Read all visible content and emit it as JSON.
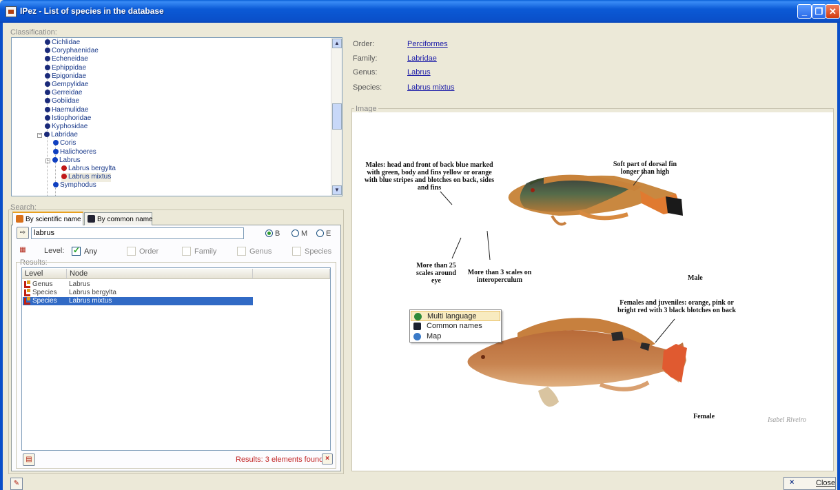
{
  "window": {
    "title": "IPez - List of species in the database",
    "controls": {
      "minimize": "_",
      "maximize": "❐",
      "close": "✕"
    }
  },
  "classification": {
    "label": "Classification:",
    "tree": [
      {
        "label": "Cichlidae",
        "level": "family",
        "icon": "family-node-icon"
      },
      {
        "label": "Coryphaenidae",
        "level": "family",
        "icon": "family-node-icon"
      },
      {
        "label": "Echeneidae",
        "level": "family",
        "icon": "family-node-icon"
      },
      {
        "label": "Ephippidae",
        "level": "family",
        "icon": "family-node-icon"
      },
      {
        "label": "Epigonidae",
        "level": "family",
        "icon": "family-node-icon"
      },
      {
        "label": "Gempylidae",
        "level": "family",
        "icon": "family-node-icon"
      },
      {
        "label": "Gerreidae",
        "level": "family",
        "icon": "family-node-icon"
      },
      {
        "label": "Gobiidae",
        "level": "family",
        "icon": "family-node-icon"
      },
      {
        "label": "Haemulidae",
        "level": "family",
        "icon": "family-node-icon"
      },
      {
        "label": "Istiophoridae",
        "level": "family",
        "icon": "family-node-icon"
      },
      {
        "label": "Kyphosidae",
        "level": "family",
        "icon": "family-node-icon"
      },
      {
        "label": "Labridae",
        "level": "family",
        "icon": "family-node-icon",
        "expanded": true
      },
      {
        "label": "Coris",
        "level": "genus",
        "icon": "genus-node-icon"
      },
      {
        "label": "Halichoeres",
        "level": "genus",
        "icon": "genus-node-icon"
      },
      {
        "label": "Labrus",
        "level": "genus",
        "icon": "genus-node-icon",
        "expanded": true
      },
      {
        "label": "Labrus bergylta",
        "level": "species",
        "icon": "species-node-icon"
      },
      {
        "label": "Labrus mixtus",
        "level": "species",
        "icon": "species-node-icon",
        "selected": true
      },
      {
        "label": "Symphodus",
        "level": "genus",
        "icon": "genus-node-icon"
      }
    ]
  },
  "search": {
    "label": "Search:",
    "tabs": [
      {
        "label": "By scientific name",
        "active": true,
        "icon": "fish-icon"
      },
      {
        "label": "By common name",
        "active": false,
        "icon": "fish-dark-icon"
      }
    ],
    "query": "labrus",
    "modes": [
      {
        "label": "B",
        "selected": true
      },
      {
        "label": "M",
        "selected": false
      },
      {
        "label": "E",
        "selected": false
      }
    ],
    "level_label": "Level:",
    "levels": [
      {
        "label": "Any",
        "checked": true
      },
      {
        "label": "Order",
        "checked": false
      },
      {
        "label": "Family",
        "checked": false
      },
      {
        "label": "Genus",
        "checked": false
      },
      {
        "label": "Species",
        "checked": false
      }
    ],
    "results_label": "Results:",
    "columns": [
      "Level",
      "Node"
    ],
    "results": [
      {
        "level": "Genus",
        "node": "Labrus",
        "selected": false
      },
      {
        "level": "Species",
        "node": "Labrus bergylta",
        "selected": false
      },
      {
        "level": "Species",
        "node": "Labrus mixtus",
        "selected": true
      }
    ],
    "results_count": "Results: 3 elements found"
  },
  "details": {
    "order_label": "Order:",
    "order": "Perciformes",
    "family_label": "Family:",
    "family": "Labridae",
    "genus_label": "Genus:",
    "genus": "Labrus",
    "species_label": "Species:",
    "species": "Labrus mixtus"
  },
  "image": {
    "label": "Image",
    "annotations": {
      "males": "Males: head and front of back blue marked with green, body and fins yellow or orange with blue stripes and blotches on back, sides and fins",
      "dorsal": "Soft part of dorsal fin longer than high",
      "scales_eye": "More than 25 scales around eye",
      "scales_operculum": "More than 3 scales on interoperculum",
      "male": "Male",
      "females": "Females and juveniles: orange, pink or bright red with 3 black blotches on back",
      "female": "Female",
      "credit": "Isabel Riveiro"
    }
  },
  "context_menu": {
    "items": [
      {
        "label": "Multi language",
        "icon": "globe-icon",
        "highlighted": true
      },
      {
        "label": "Common names",
        "icon": "fish-dark-icon",
        "highlighted": false
      },
      {
        "label": "Map",
        "icon": "map-globe-icon",
        "highlighted": false
      }
    ]
  },
  "footer": {
    "close_label": "Close"
  },
  "colors": {
    "titlebar": "#0a4fc9",
    "selection": "#316ac5",
    "link": "#1a1aa8",
    "results_count": "#c02020"
  }
}
